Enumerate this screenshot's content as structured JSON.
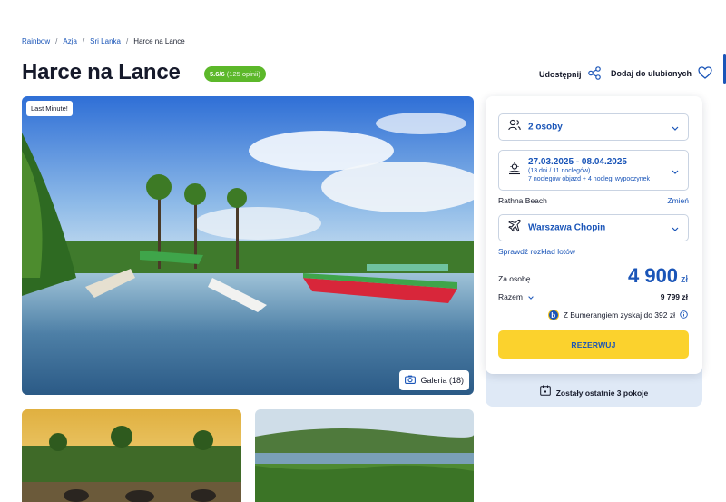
{
  "breadcrumb": {
    "items": [
      "Rainbow",
      "Azja",
      "Sri Lanka"
    ],
    "current": "Harce na Lance",
    "separator": "/"
  },
  "hotel": {
    "title": "Harce na Lance",
    "rating_score": "5.6/6",
    "rating_count": "(125 opinii)"
  },
  "actions": {
    "share_label": "Udostępnij",
    "favorite_label": "Dodaj do ulubionych"
  },
  "gallery": {
    "badge": "Last Minute!",
    "gallery_label": "Galeria (18)"
  },
  "booking": {
    "persons": "2 osoby",
    "dates": "27.03.2025 - 08.04.2025",
    "dates_nights": "(13 dni / 11 noclegów)",
    "dates_detail": "7 noclegów objazd + 4 noclegi wypoczynek",
    "hotel_name": "Rathna Beach",
    "change_link": "Zmień",
    "departure": "Warszawa Chopin",
    "flights_link": "Sprawdź rozkład lotów",
    "per_person_label": "Za osobę",
    "price": "4 900",
    "currency": "zł",
    "total_label": "Razem",
    "total_value": "9 799 zł",
    "bumerang_text": "Z Bumerangiem zyskaj do 392 zł",
    "reserve_label": "REZERWUJ",
    "rooms_left": "Zostały ostatnie 3 pokoje"
  },
  "colors": {
    "accent_blue": "#1a55b8",
    "rating_green": "#5cb82a",
    "reserve_yellow": "#fbd22d",
    "rooms_bg": "#dfe9f6"
  }
}
